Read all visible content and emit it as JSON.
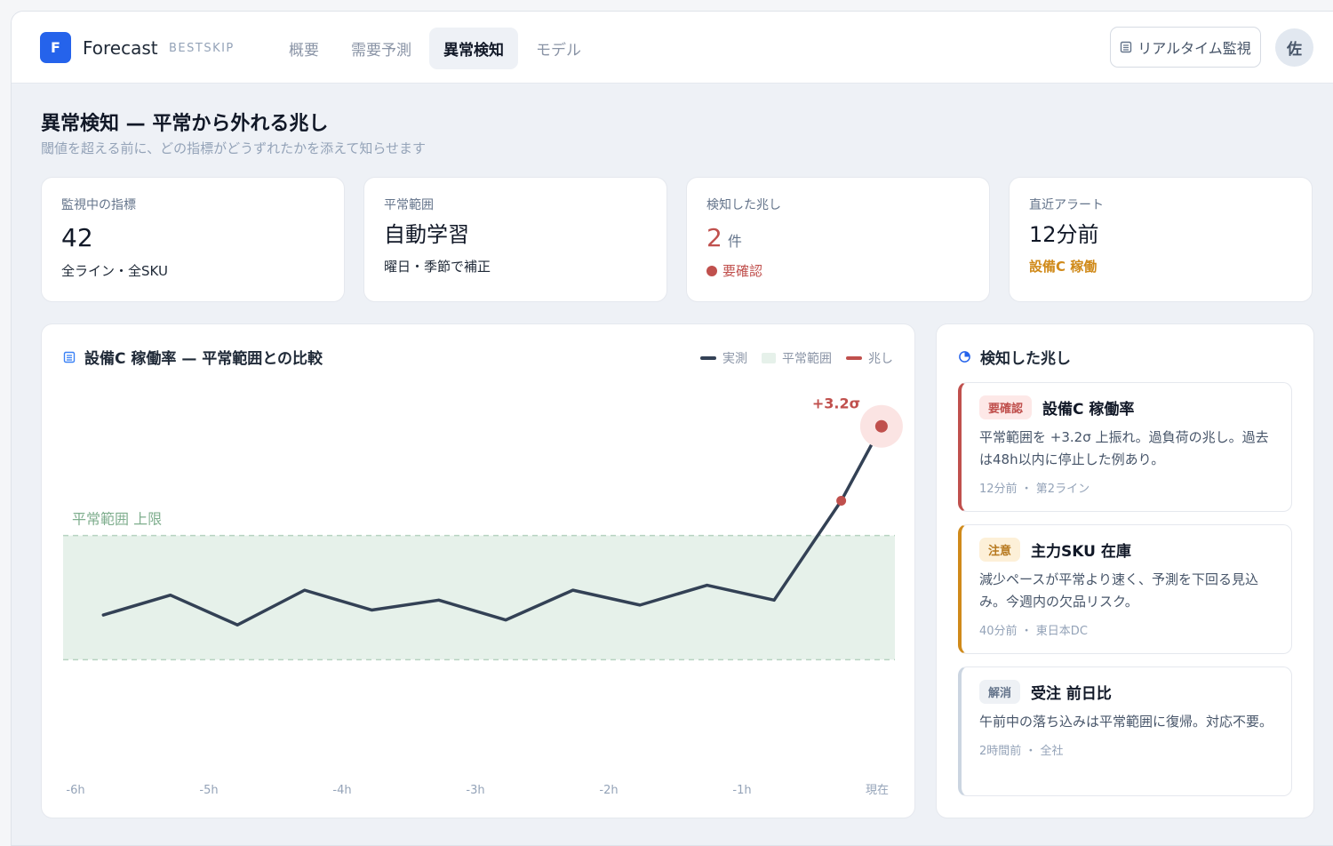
{
  "header": {
    "logo_letter": "F",
    "brand": "Forecast",
    "brand_sub": "BESTSKIP",
    "tabs": [
      {
        "label": "概要",
        "active": false
      },
      {
        "label": "需要予測",
        "active": false
      },
      {
        "label": "異常検知",
        "active": true
      },
      {
        "label": "モデル",
        "active": false
      }
    ],
    "realtime_button": "リアルタイム監視",
    "avatar": "佐"
  },
  "page": {
    "title": "異常検知 — 平常から外れる兆し",
    "subtitle": "閾値を超える前に、どの指標がどうずれたかを添えて知らせます"
  },
  "kpis": [
    {
      "label": "監視中の指標",
      "value": "42",
      "note": "全ライン・全SKU"
    },
    {
      "label": "平常範囲",
      "value": "自動学習",
      "note": "曜日・季節で補正"
    },
    {
      "label": "検知した兆し",
      "value": "2",
      "unit": "件",
      "note": "要確認"
    },
    {
      "label": "直近アラート",
      "value": "12分前",
      "note": "設備C 稼働"
    }
  ],
  "chart": {
    "title": "設備C 稼働率 — 平常範囲との比較",
    "legend": {
      "actual": "実測",
      "normal": "平常範囲",
      "signal": "兆し"
    },
    "band_label": "平常範囲 上限",
    "peak_label": "+3.2σ"
  },
  "chart_data": {
    "type": "line",
    "title": "設備C 稼働率 — 平常範囲との比較",
    "x_ticks": [
      "-6h",
      "-5h",
      "-4h",
      "-3h",
      "-2h",
      "-1h",
      "現在"
    ],
    "x": [
      -5.8,
      -5.3,
      -4.8,
      -4.3,
      -3.8,
      -3.3,
      -2.8,
      -2.3,
      -1.8,
      -1.3,
      -0.8,
      -0.3,
      0.0
    ],
    "series": [
      {
        "name": "実測",
        "values": [
          -0.6,
          -0.2,
          -0.8,
          -0.1,
          -0.5,
          -0.3,
          -0.7,
          -0.1,
          -0.4,
          0.0,
          -0.3,
          1.7,
          3.2
        ]
      }
    ],
    "normal_range": [
      -1.5,
      1.0
    ],
    "signal_points": [
      {
        "x": -0.3,
        "y": 1.7
      },
      {
        "x": 0.0,
        "y": 3.2
      }
    ],
    "peak_annotation": "+3.2σ",
    "xlim": [
      -6.1,
      0.1
    ],
    "ylim": [
      -4.5,
      4.0
    ],
    "grid": false,
    "legend_position": "top-right",
    "colors": {
      "actual": "#334155",
      "normal": "#e6f1ea",
      "signal": "#c0504d"
    }
  },
  "signals": {
    "title": "検知した兆し",
    "items": [
      {
        "badge": "要確認",
        "title": "設備C 稼働率",
        "desc": "平常範囲を +3.2σ 上振れ。過負荷の兆し。過去は48h以内に停止した例あり。",
        "meta": "12分前 ・ 第2ライン",
        "accent": "#c0504d",
        "badge_bg": "#fde8e7",
        "badge_fg": "#c0504d"
      },
      {
        "badge": "注意",
        "title": "主力SKU 在庫",
        "desc": "減少ペースが平常より速く、予測を下回る見込み。今週内の欠品リスク。",
        "meta": "40分前 ・ 東日本DC",
        "accent": "#d08a1a",
        "badge_bg": "#fdf0d8",
        "badge_fg": "#b7791f"
      },
      {
        "badge": "解消",
        "title": "受注 前日比",
        "desc": "午前中の落ち込みは平常範囲に復帰。対応不要。",
        "meta": "2時間前 ・ 全社",
        "accent": "#cbd5e1",
        "badge_bg": "#eef1f5",
        "badge_fg": "#64748b"
      }
    ]
  }
}
